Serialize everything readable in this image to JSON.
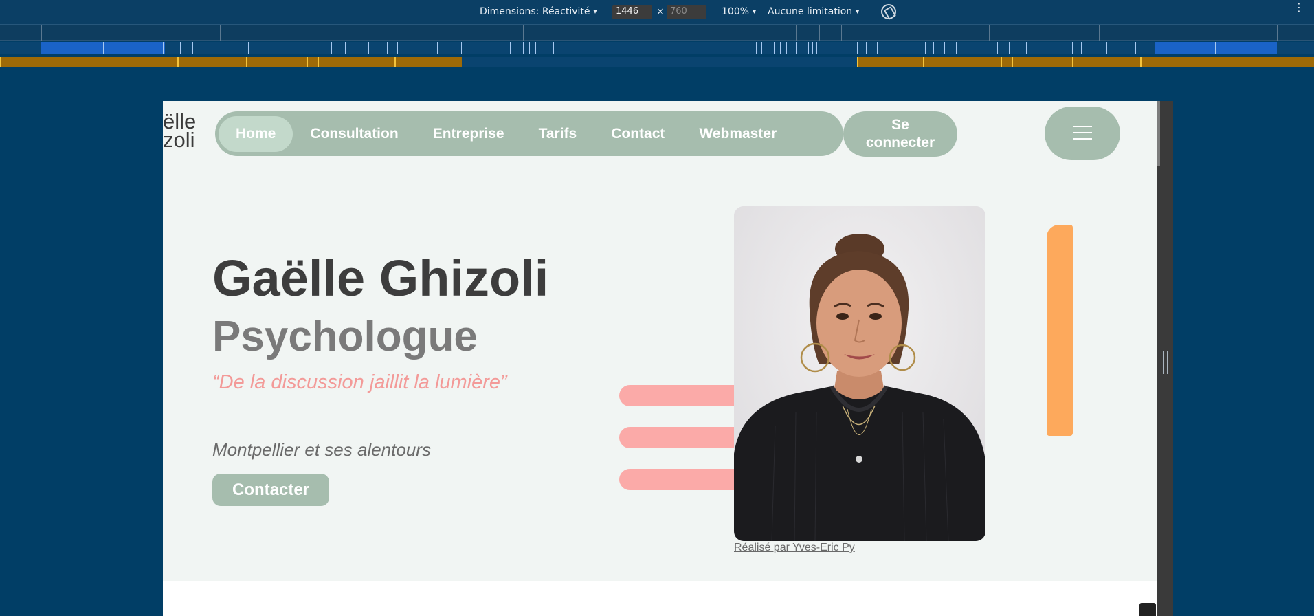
{
  "devtools": {
    "dimensions_label": "Dimensions: Réactivité",
    "width_value": "1446",
    "times": "×",
    "height_placeholder": "760",
    "zoom": "100%",
    "throttle": "Aucune limitation",
    "caret": "▾",
    "kebab": "⋮"
  },
  "site": {
    "logo_line1": "ëlle",
    "logo_line2": "zoli",
    "nav": [
      {
        "label": "Home",
        "active": true
      },
      {
        "label": "Consultation"
      },
      {
        "label": "Entreprise"
      },
      {
        "label": "Tarifs"
      },
      {
        "label": "Contact"
      },
      {
        "label": "Webmaster"
      }
    ],
    "login_line1": "Se",
    "login_line2": "connecter"
  },
  "hero": {
    "name": "Gaëlle Ghizoli",
    "role": "Psychologue",
    "quote": "“De la discussion jaillit la lumière”",
    "location": "Montpellier et ses alentours",
    "cta": "Contacter",
    "photo_credit": "Réalisé par Yves-Eric Py"
  },
  "colors": {
    "sage": "#a6bdae",
    "pink": "#fbaaa8",
    "orange": "#fda95c",
    "page_bg": "#f1f5f3",
    "devtools_bg": "#013e66"
  }
}
